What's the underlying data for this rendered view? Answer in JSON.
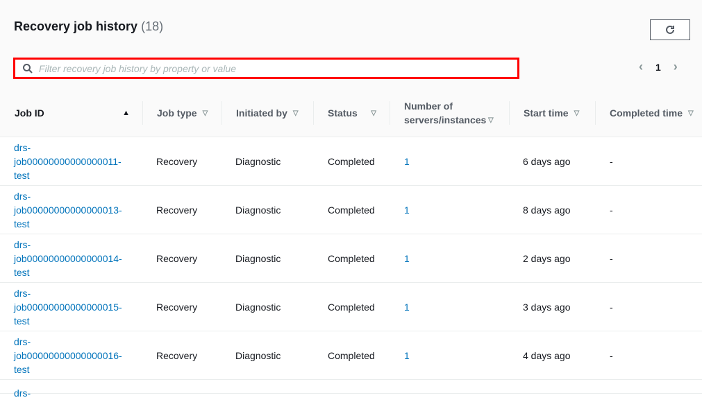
{
  "header": {
    "title": "Recovery job history",
    "count": "(18)"
  },
  "search": {
    "placeholder": "Filter recovery job history by property or value",
    "value": ""
  },
  "pagination": {
    "prev": "‹",
    "page": "1",
    "next": "›"
  },
  "columns": [
    "Job ID",
    "Job type",
    "Initiated by",
    "Status",
    "Number of servers/instances",
    "Start time",
    "Completed time"
  ],
  "rows": [
    {
      "id": "drs-job00000000000000011-test",
      "type": "Recovery",
      "by": "Diagnostic",
      "status": "Completed",
      "num": "1",
      "start": "6 days ago",
      "done": "-"
    },
    {
      "id": "drs-job00000000000000013-test",
      "type": "Recovery",
      "by": "Diagnostic",
      "status": "Completed",
      "num": "1",
      "start": "8 days ago",
      "done": "-"
    },
    {
      "id": "drs-job00000000000000014-test",
      "type": "Recovery",
      "by": "Diagnostic",
      "status": "Completed",
      "num": "1",
      "start": "2 days ago",
      "done": "-"
    },
    {
      "id": "drs-job00000000000000015-test",
      "type": "Recovery",
      "by": "Diagnostic",
      "status": "Completed",
      "num": "1",
      "start": "3 days ago",
      "done": "-"
    },
    {
      "id": "drs-job00000000000000016-test",
      "type": "Recovery",
      "by": "Diagnostic",
      "status": "Completed",
      "num": "1",
      "start": "4 days ago",
      "done": "-"
    },
    {
      "id": "drs-",
      "type": "",
      "by": "",
      "status": "",
      "num": "",
      "start": "",
      "done": ""
    }
  ]
}
